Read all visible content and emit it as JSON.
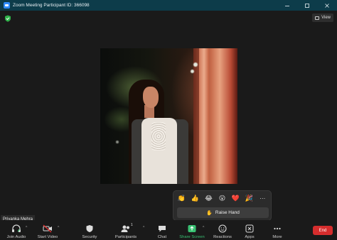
{
  "window": {
    "title": "Zoom Meeting Participant ID: 366098",
    "controls": [
      "minimize",
      "maximize",
      "close"
    ]
  },
  "top": {
    "view_label": "View",
    "security_status_icon": "green-shield-icon"
  },
  "participant": {
    "name": "Priyanka Mehra"
  },
  "reactions": {
    "emojis": [
      "👏",
      "👍",
      "😂",
      "😮",
      "❤️",
      "🎉"
    ],
    "more_label": "⋯",
    "raise_hand_label": "Raise Hand",
    "raise_hand_icon": "✋"
  },
  "toolbar": {
    "join_audio": "Join Audio",
    "start_video": "Start Video",
    "security": "Security",
    "participants": "Participants",
    "participants_count": "1",
    "chat": "Chat",
    "share_screen": "Share Screen",
    "reactions": "Reactions",
    "apps": "Apps",
    "more": "More",
    "end": "End"
  },
  "colors": {
    "titlebar": "#0d3c4a",
    "share_green": "#38c172",
    "end_red": "#d62d2d"
  }
}
